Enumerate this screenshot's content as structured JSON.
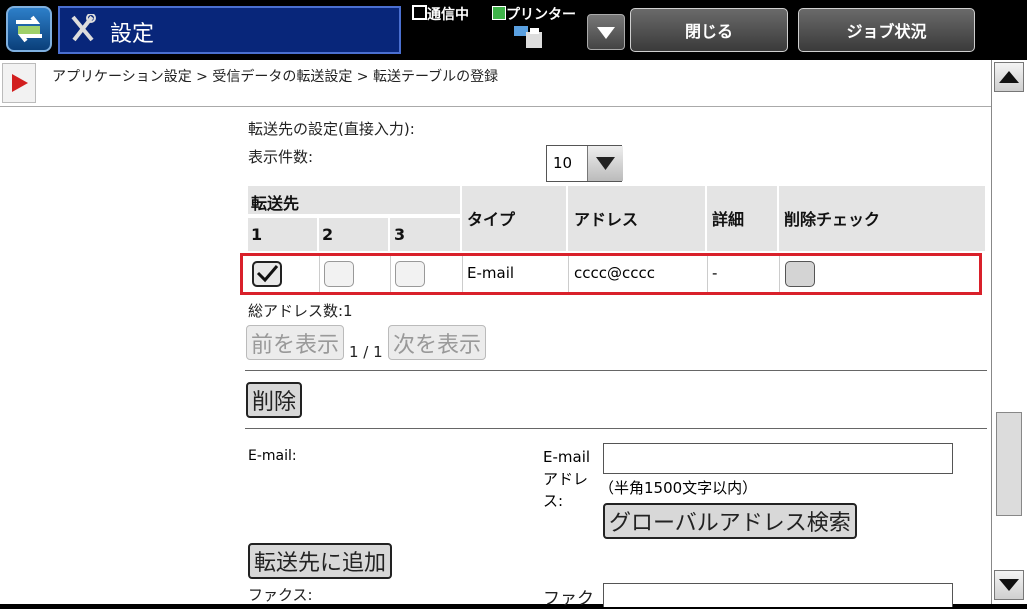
{
  "header": {
    "title": "設定",
    "status_comm": "通信中",
    "status_printer": "プリンター",
    "close_label": "閉じる",
    "job_label": "ジョブ状況"
  },
  "breadcrumb": "アプリケーション設定 > 受信データの転送設定 > 転送テーブルの登録",
  "destination": {
    "section_label": "転送先の設定(直接入力):",
    "display_count_label": "表示件数:",
    "display_count_value": "10"
  },
  "table": {
    "group_header": "転送先",
    "sub_headers": [
      "1",
      "2",
      "3"
    ],
    "col_type": "タイプ",
    "col_address": "アドレス",
    "col_detail": "詳細",
    "col_delete": "削除チェック",
    "row": {
      "type": "E-mail",
      "address": "cccc@cccc",
      "detail": "-"
    }
  },
  "total_label": "総アドレス数:1",
  "pager": {
    "prev_label": "前を表示",
    "page_text": "1 / 1",
    "next_label": "次を表示"
  },
  "delete_label": "削除",
  "email": {
    "label": "E-mail:",
    "address_label": "E-mailアドレス:",
    "hint": "（半角1500文字以内）",
    "search_label": "グローバルアドレス検索",
    "add_label": "転送先に追加"
  },
  "fax": {
    "label": "ファクス:",
    "number_label": "ファク"
  },
  "colors": {
    "title_bg": "#08267a",
    "highlight": "#d9202a"
  }
}
